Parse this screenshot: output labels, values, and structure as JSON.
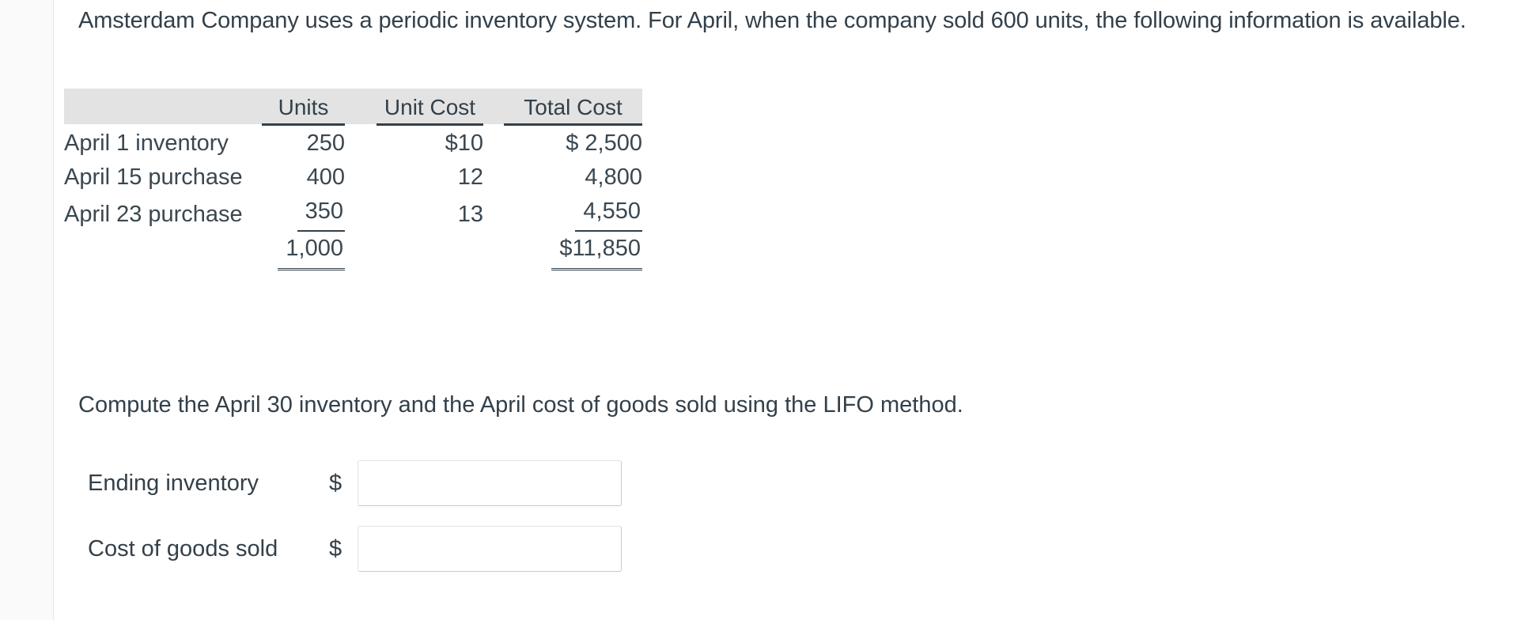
{
  "problem": {
    "intro": "Amsterdam Company uses a periodic inventory system. For April, when the company sold 600 units, the following information is available.",
    "prompt": "Compute the April 30 inventory and the April cost of goods sold using the LIFO method."
  },
  "table": {
    "headers": {
      "blank": "",
      "units": "Units",
      "unit_cost": "Unit Cost",
      "total_cost": "Total Cost"
    },
    "rows": [
      {
        "label": "April 1 inventory",
        "units": "250",
        "unit_cost": "$10",
        "total_cost": "$ 2,500"
      },
      {
        "label": "April 15 purchase",
        "units": "400",
        "unit_cost": "12",
        "total_cost": "4,800"
      },
      {
        "label": "April 23 purchase",
        "units": "350",
        "unit_cost": "13",
        "total_cost": "4,550"
      }
    ],
    "totals": {
      "label": "",
      "units": "1,000",
      "unit_cost": "",
      "total_cost": "$11,850"
    }
  },
  "answers": {
    "ending_inventory": {
      "label": "Ending inventory",
      "currency": "$",
      "value": "",
      "placeholder": ""
    },
    "cost_of_goods_sold": {
      "label": "Cost of goods sold",
      "currency": "$",
      "value": "",
      "placeholder": ""
    }
  },
  "colors": {
    "text": "#33404a",
    "header_band": "#e3e3e3",
    "rail": "#fafafa",
    "input_border": "#d6d6d6"
  }
}
